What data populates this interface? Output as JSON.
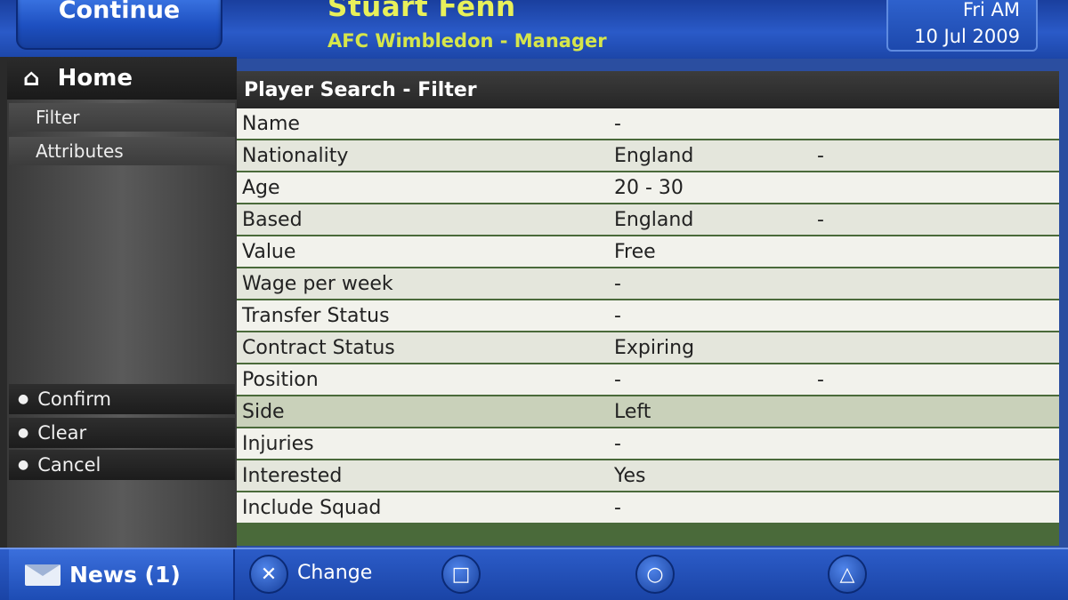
{
  "header": {
    "continue_label": "Continue",
    "manager_name": "Stuart Fenn",
    "club_role": "AFC Wimbledon - Manager",
    "date_day": "Fri AM",
    "date_full": "10 Jul 2009"
  },
  "sidebar": {
    "home_label": "Home",
    "submenu": [
      {
        "label": "Filter"
      },
      {
        "label": "Attributes"
      }
    ],
    "actions": [
      {
        "label": "Confirm"
      },
      {
        "label": "Clear"
      },
      {
        "label": "Cancel"
      }
    ]
  },
  "table": {
    "title": "Player Search - Filter",
    "rows": [
      {
        "label": "Name",
        "value": "-",
        "extra": ""
      },
      {
        "label": "Nationality",
        "value": "England",
        "extra": "-"
      },
      {
        "label": "Age",
        "value": "20 - 30",
        "extra": ""
      },
      {
        "label": "Based",
        "value": "England",
        "extra": "-"
      },
      {
        "label": "Value",
        "value": "Free",
        "extra": ""
      },
      {
        "label": "Wage per week",
        "value": "-",
        "extra": ""
      },
      {
        "label": "Transfer Status",
        "value": "-",
        "extra": ""
      },
      {
        "label": "Contract Status",
        "value": "Expiring",
        "extra": ""
      },
      {
        "label": "Position",
        "value": "-",
        "extra": "-"
      },
      {
        "label": "Side",
        "value": "Left",
        "extra": ""
      },
      {
        "label": "Injuries",
        "value": "-",
        "extra": ""
      },
      {
        "label": "Interested",
        "value": "Yes",
        "extra": ""
      },
      {
        "label": "Include Squad",
        "value": "-",
        "extra": ""
      }
    ]
  },
  "bottom_bar": {
    "news_label": "News (1)",
    "change_label": "Change",
    "buttons": {
      "cross": "✕",
      "square": "□",
      "circle": "○",
      "triangle": "△"
    }
  }
}
